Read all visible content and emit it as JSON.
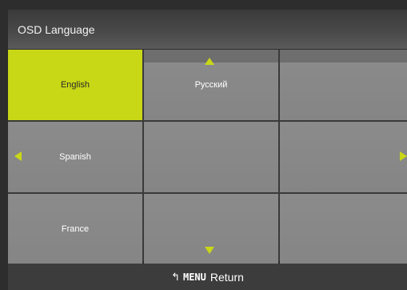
{
  "osd": {
    "title": "OSD Language",
    "languages": [
      "English",
      "Русский",
      "",
      "Spanish",
      "",
      "",
      "France",
      "",
      ""
    ],
    "selected_language": "English",
    "footer": {
      "return_icon": "↰",
      "menu_label": "MENU",
      "return_label": "Return"
    },
    "colors": {
      "accent": "#c8d716",
      "cell": "#8b8b8b",
      "bar": "#3c3c3c"
    },
    "icons": [
      "arrow-up-icon",
      "arrow-down-icon",
      "arrow-left-icon",
      "arrow-right-icon",
      "return-icon"
    ]
  }
}
